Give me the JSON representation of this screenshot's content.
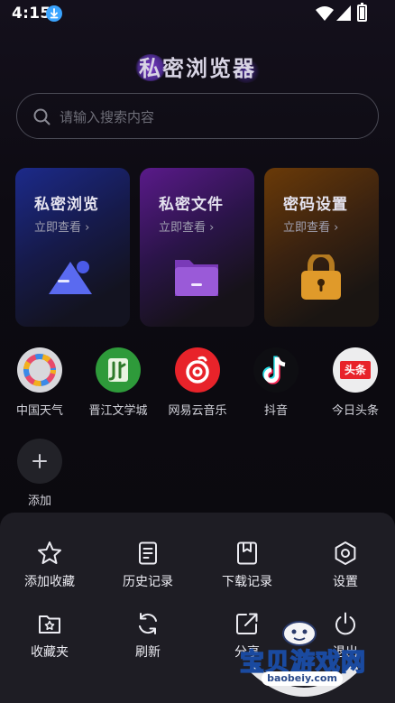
{
  "status_bar": {
    "time": "4:15"
  },
  "app": {
    "title": "私密浏览器"
  },
  "search": {
    "placeholder": "请输入搜索内容"
  },
  "cards": [
    {
      "title": "私密浏览",
      "link": "立即查看 ›",
      "icon": "triangle-icon"
    },
    {
      "title": "私密文件",
      "link": "立即查看 ›",
      "icon": "folder-icon"
    },
    {
      "title": "密码设置",
      "link": "立即查看 ›",
      "icon": "lock-icon"
    }
  ],
  "shortcuts": [
    {
      "label": "中国天气",
      "icon": "weather-icon"
    },
    {
      "label": "晋江文学城",
      "icon": "jinjiang-icon"
    },
    {
      "label": "网易云音乐",
      "icon": "netease-music-icon"
    },
    {
      "label": "抖音",
      "icon": "douyin-icon"
    },
    {
      "label": "今日头条",
      "icon": "toutiao-icon",
      "logo_text": "头条"
    }
  ],
  "add": {
    "label": "添加"
  },
  "menu": {
    "items": [
      {
        "label": "添加收藏",
        "icon": "star-icon"
      },
      {
        "label": "历史记录",
        "icon": "history-icon"
      },
      {
        "label": "下载记录",
        "icon": "download-icon"
      },
      {
        "label": "设置",
        "icon": "gear-icon"
      },
      {
        "label": "收藏夹",
        "icon": "favorites-folder-icon"
      },
      {
        "label": "刷新",
        "icon": "refresh-icon"
      },
      {
        "label": "分享",
        "icon": "share-icon"
      },
      {
        "label": "退出",
        "icon": "power-icon"
      }
    ]
  },
  "watermark": {
    "text": "宝贝游戏网",
    "url": "baobeiy.com"
  },
  "colors": {
    "accent_blue": "#3aa4ff",
    "netease_red": "#e8232a",
    "jinjiang_green": "#2e9a3a"
  }
}
